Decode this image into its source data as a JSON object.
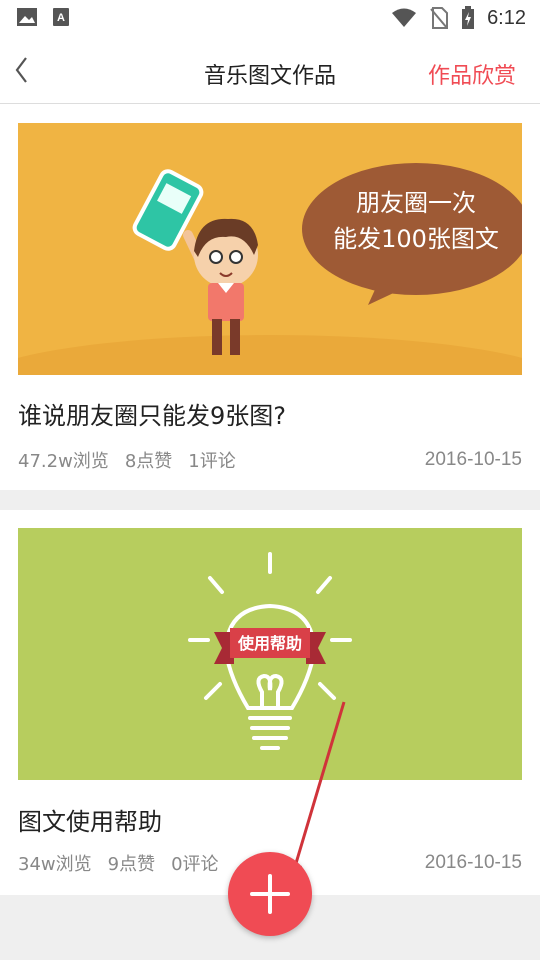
{
  "status_bar": {
    "time": "6:12",
    "icons": [
      "image-icon",
      "text-a-icon",
      "wifi-icon",
      "no-sim-icon",
      "battery-charging-icon"
    ]
  },
  "nav": {
    "title": "音乐图文作品",
    "right_link": "作品欣赏"
  },
  "works": [
    {
      "title": "谁说朋友圈只能发9张图?",
      "views": "47.2w浏览",
      "likes": "8点赞",
      "comments": "1评论",
      "date": "2016-10-15",
      "cover": {
        "background": "#f0b443",
        "bubble_lines": [
          "朋友圈一次",
          "能发100张图文"
        ]
      }
    },
    {
      "title": "图文使用帮助",
      "views": "34w浏览",
      "likes": "9点赞",
      "comments": "0评论",
      "date": "2016-10-15",
      "cover": {
        "background": "#b7cd5e",
        "banner_text": "使用帮助"
      }
    }
  ],
  "colors": {
    "accent": "#f04b54",
    "annotation_arrow": "#d0333a"
  },
  "fab_icon": "plus-icon"
}
